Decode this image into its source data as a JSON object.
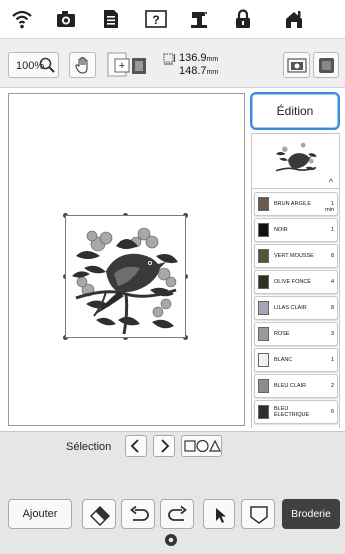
{
  "toolbar": {
    "zoom_label": "100%",
    "size_width": "136.9",
    "size_height": "148.7",
    "size_unit": "mm"
  },
  "edit_panel": {
    "edition_label": "Édition",
    "threads": [
      {
        "name": "BRUN ARGILE",
        "count": "1",
        "extra": "min",
        "color": "#6b5a4c"
      },
      {
        "name": "NOIR",
        "count": "1",
        "extra": "",
        "color": "#111111"
      },
      {
        "name": "VERT MOUSSE",
        "count": "8",
        "extra": "",
        "color": "#4b5a3b"
      },
      {
        "name": "OLIVE FONCÉ",
        "count": "4",
        "extra": "",
        "color": "#2b3224"
      },
      {
        "name": "LILAS CLAIR",
        "count": "8",
        "extra": "",
        "color": "#a9a3b5"
      },
      {
        "name": "ROSE",
        "count": "3",
        "extra": "",
        "color": "#9a9a9a"
      },
      {
        "name": "BLANC",
        "count": "1",
        "extra": "",
        "color": "#f2f2f2"
      },
      {
        "name": "BLEU CLAIR",
        "count": "2",
        "extra": "",
        "color": "#8d8d8d"
      },
      {
        "name": "BLEU ÉLECTRIQUE",
        "count": "6",
        "extra": "",
        "color": "#2d2d2d"
      }
    ]
  },
  "bottom": {
    "selection_label": "Sélection",
    "ajouter_label": "Ajouter",
    "broderie_label": "Broderie"
  },
  "colors": {
    "accent": "#3a89db",
    "dark_button": "#404040"
  }
}
